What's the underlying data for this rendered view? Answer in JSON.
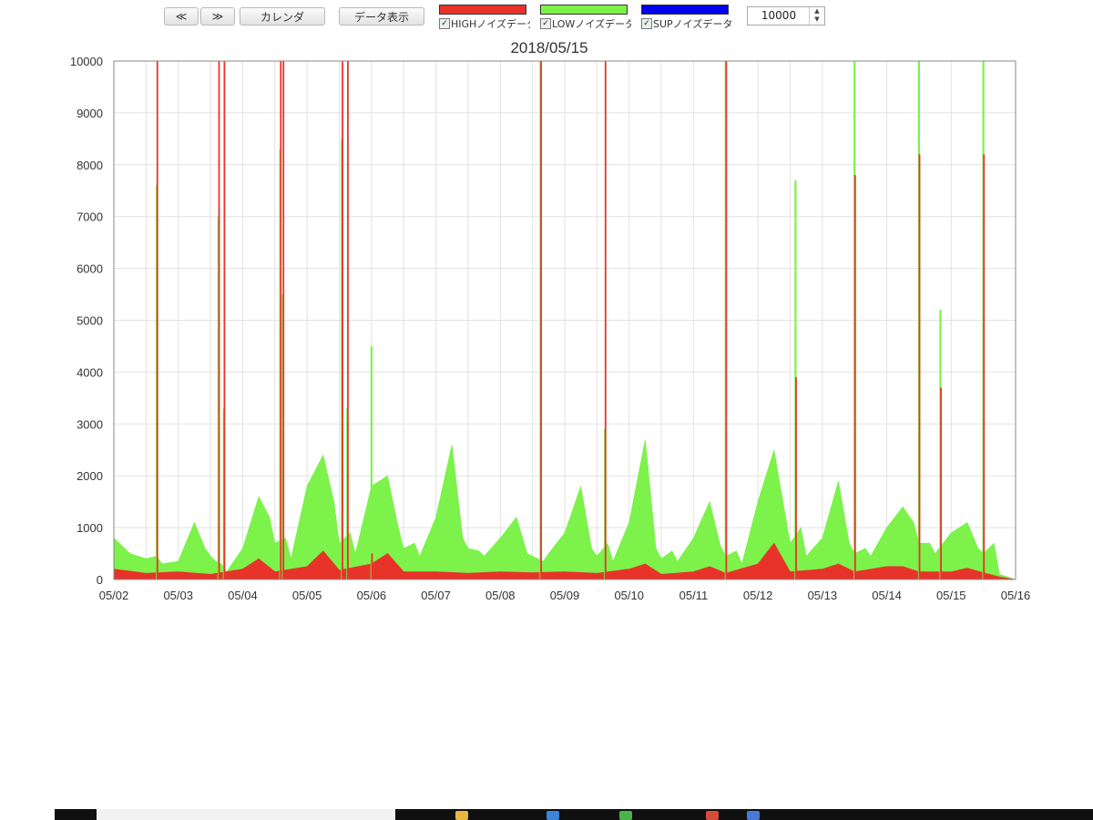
{
  "toolbar": {
    "prev_label": "≪",
    "next_label": "≫",
    "calendar_label": "カレンダ",
    "show_data_label": "データ表示",
    "max_value": "10000"
  },
  "legend": [
    {
      "label": "HIGHノイズデータ",
      "color": "#e8332a",
      "checked": true
    },
    {
      "label": "LOWノイズデータ",
      "color": "#7cf24a",
      "checked": true
    },
    {
      "label": "SUPノイズデータ",
      "color": "#0000ee",
      "checked": true
    }
  ],
  "chart_data": {
    "type": "area",
    "title": "2018/05/15",
    "xlabel": "",
    "ylabel": "",
    "ylim": [
      0,
      10000
    ],
    "yticks": [
      "0",
      "1000",
      "2000",
      "3000",
      "4000",
      "5000",
      "6000",
      "7000",
      "8000",
      "9000",
      "10000"
    ],
    "xticks": [
      "05/02",
      "05/03",
      "05/04",
      "05/05",
      "05/06",
      "05/07",
      "05/08",
      "05/09",
      "05/10",
      "05/11",
      "05/12",
      "05/13",
      "05/14",
      "05/15",
      "05/16"
    ],
    "grid": true,
    "stacked": false,
    "series": [
      {
        "name": "LOWノイズデータ",
        "color": "#7cf24a",
        "x": [
          "05/02 00:00",
          "05/02 06:00",
          "05/02 12:00",
          "05/02 16:00",
          "05/02 18:00",
          "05/03 00:00",
          "05/03 06:00",
          "05/03 10:00",
          "05/03 12:00",
          "05/03 14:00",
          "05/03 16:00",
          "05/03 18:00",
          "05/04 00:00",
          "05/04 06:00",
          "05/04 10:00",
          "05/04 12:00",
          "05/04 16:00",
          "05/04 18:00",
          "05/05 00:00",
          "05/05 06:00",
          "05/05 10:00",
          "05/05 12:00",
          "05/05 16:00",
          "05/05 18:00",
          "05/06 00:00",
          "05/06 06:00",
          "05/06 10:00",
          "05/06 12:00",
          "05/06 16:00",
          "05/06 18:00",
          "05/07 00:00",
          "05/07 06:00",
          "05/07 10:00",
          "05/07 12:00",
          "05/07 16:00",
          "05/07 18:00",
          "05/08 00:00",
          "05/08 06:00",
          "05/08 10:00",
          "05/08 12:00",
          "05/08 16:00",
          "05/08 18:00",
          "05/09 00:00",
          "05/09 06:00",
          "05/09 10:00",
          "05/09 12:00",
          "05/09 16:00",
          "05/09 18:00",
          "05/10 00:00",
          "05/10 06:00",
          "05/10 10:00",
          "05/10 12:00",
          "05/10 16:00",
          "05/10 18:00",
          "05/11 00:00",
          "05/11 06:00",
          "05/11 10:00",
          "05/11 12:00",
          "05/11 16:00",
          "05/11 18:00",
          "05/12 00:00",
          "05/12 06:00",
          "05/12 10:00",
          "05/12 12:00",
          "05/12 16:00",
          "05/12 18:00",
          "05/13 00:00",
          "05/13 06:00",
          "05/13 10:00",
          "05/13 12:00",
          "05/13 16:00",
          "05/13 18:00",
          "05/14 00:00",
          "05/14 06:00",
          "05/14 10:00",
          "05/14 12:00",
          "05/14 16:00",
          "05/14 18:00",
          "05/15 00:00",
          "05/15 06:00",
          "05/15 10:00",
          "05/15 12:00",
          "05/15 16:00",
          "05/15 18:00",
          "05/16 00:00"
        ],
        "values": [
          800,
          500,
          400,
          450,
          300,
          350,
          1100,
          600,
          450,
          350,
          300,
          150,
          600,
          1600,
          1200,
          700,
          800,
          400,
          1800,
          2400,
          1500,
          700,
          900,
          500,
          1800,
          2000,
          1000,
          600,
          700,
          450,
          1200,
          2600,
          800,
          600,
          550,
          450,
          800,
          1200,
          500,
          450,
          350,
          500,
          900,
          1800,
          600,
          450,
          700,
          350,
          1100,
          2700,
          600,
          400,
          550,
          350,
          800,
          1500,
          650,
          450,
          550,
          300,
          1500,
          2500,
          1300,
          700,
          1000,
          450,
          800,
          1900,
          700,
          500,
          600,
          450,
          1000,
          1400,
          1100,
          700,
          700,
          500,
          900,
          1100,
          600,
          500,
          700,
          100,
          0
        ]
      },
      {
        "name": "HIGHノイズデータ",
        "color": "#e8332a",
        "x": [
          "05/02 00:00",
          "05/02 12:00",
          "05/03 00:00",
          "05/03 12:00",
          "05/04 00:00",
          "05/04 06:00",
          "05/04 12:00",
          "05/05 00:00",
          "05/05 06:00",
          "05/05 12:00",
          "05/06 00:00",
          "05/06 06:00",
          "05/06 12:00",
          "05/07 00:00",
          "05/07 12:00",
          "05/08 00:00",
          "05/08 12:00",
          "05/09 00:00",
          "05/09 12:00",
          "05/10 00:00",
          "05/10 06:00",
          "05/10 12:00",
          "05/11 00:00",
          "05/11 06:00",
          "05/11 12:00",
          "05/12 00:00",
          "05/12 06:00",
          "05/12 12:00",
          "05/13 00:00",
          "05/13 06:00",
          "05/13 12:00",
          "05/14 00:00",
          "05/14 06:00",
          "05/14 12:00",
          "05/15 00:00",
          "05/15 06:00",
          "05/15 12:00",
          "05/15 18:00",
          "05/16 00:00"
        ],
        "values": [
          200,
          120,
          150,
          100,
          200,
          400,
          150,
          250,
          550,
          180,
          300,
          500,
          150,
          150,
          120,
          150,
          130,
          150,
          120,
          200,
          300,
          100,
          150,
          250,
          120,
          300,
          700,
          150,
          200,
          300,
          150,
          250,
          250,
          150,
          150,
          220,
          130,
          50,
          0
        ]
      }
    ],
    "spikes": [
      {
        "x": "05/02 16:00",
        "low": 7600,
        "high": 10000
      },
      {
        "x": "05/03 15:00",
        "low": 7000,
        "high": 10000
      },
      {
        "x": "05/03 17:00",
        "low": 3300,
        "high": 10000
      },
      {
        "x": "05/04 14:00",
        "low": 8300,
        "high": 10000
      },
      {
        "x": "05/04 15:00",
        "low": 5500,
        "high": 10000
      },
      {
        "x": "05/05 13:00",
        "low": 8500,
        "high": 10000
      },
      {
        "x": "05/05 15:00",
        "low": 3300,
        "high": 10000
      },
      {
        "x": "05/06 00:00",
        "low": 4500,
        "high": 500
      },
      {
        "x": "05/08 15:00",
        "low": 10000,
        "high": 10000
      },
      {
        "x": "05/09 15:00",
        "low": 2900,
        "high": 10000
      },
      {
        "x": "05/11 12:00",
        "low": 10000,
        "high": 10000
      },
      {
        "x": "05/12 14:00",
        "low": 7700,
        "high": 3900
      },
      {
        "x": "05/13 12:00",
        "low": 10000,
        "high": 7800
      },
      {
        "x": "05/14 12:00",
        "low": 10000,
        "high": 8200
      },
      {
        "x": "05/14 20:00",
        "low": 5200,
        "high": 3700
      },
      {
        "x": "05/15 12:00",
        "low": 10000,
        "high": 8200
      }
    ]
  }
}
